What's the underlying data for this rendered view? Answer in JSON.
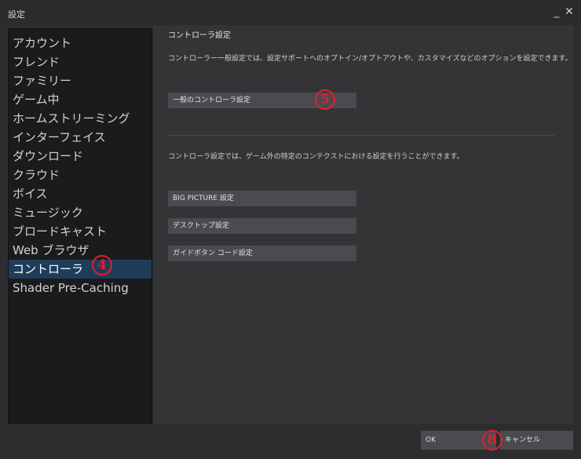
{
  "window": {
    "title": "設定",
    "minimize_glyph": "_",
    "close_glyph": "✕"
  },
  "sidebar": {
    "items": [
      {
        "label": "アカウント"
      },
      {
        "label": "フレンド"
      },
      {
        "label": "ファミリー"
      },
      {
        "label": "ゲーム中"
      },
      {
        "label": "ホームストリーミング"
      },
      {
        "label": "インターフェイス"
      },
      {
        "label": "ダウンロード"
      },
      {
        "label": "クラウド"
      },
      {
        "label": "ボイス"
      },
      {
        "label": "ミュージック"
      },
      {
        "label": "ブロードキャスト"
      },
      {
        "label": "Web ブラウザ"
      },
      {
        "label": "コントローラ"
      },
      {
        "label": "Shader Pre-Caching"
      }
    ],
    "active_item": "コントローラ"
  },
  "main": {
    "title": "コントローラ設定",
    "description1": "コントローラー一般設定では、設定サポートへのオプトイン/オプトアウトや、カスタマイズなどのオプションを設定できます。",
    "general_button": "一般のコントローラ設定",
    "description2": "コントローラ設定では、ゲーム外の特定のコンテクストにおける設定を行うことができます。",
    "big_picture_button": "BIG PICTURE 設定",
    "desktop_button": "デスクトップ設定",
    "guide_button": "ガイドボタン コード設定"
  },
  "footer": {
    "ok_label": "OK",
    "cancel_label": "キャンセル"
  },
  "callouts": {
    "sidebar_marker": "4",
    "general_marker": "5",
    "footer_marker": "8",
    "color": "#e0202c"
  },
  "colors": {
    "active_highlight": "#1f3d5a",
    "button_bg": "#4b4b4f",
    "panel_bg": "#343437",
    "sidebar_bg": "#1b1b1d"
  }
}
